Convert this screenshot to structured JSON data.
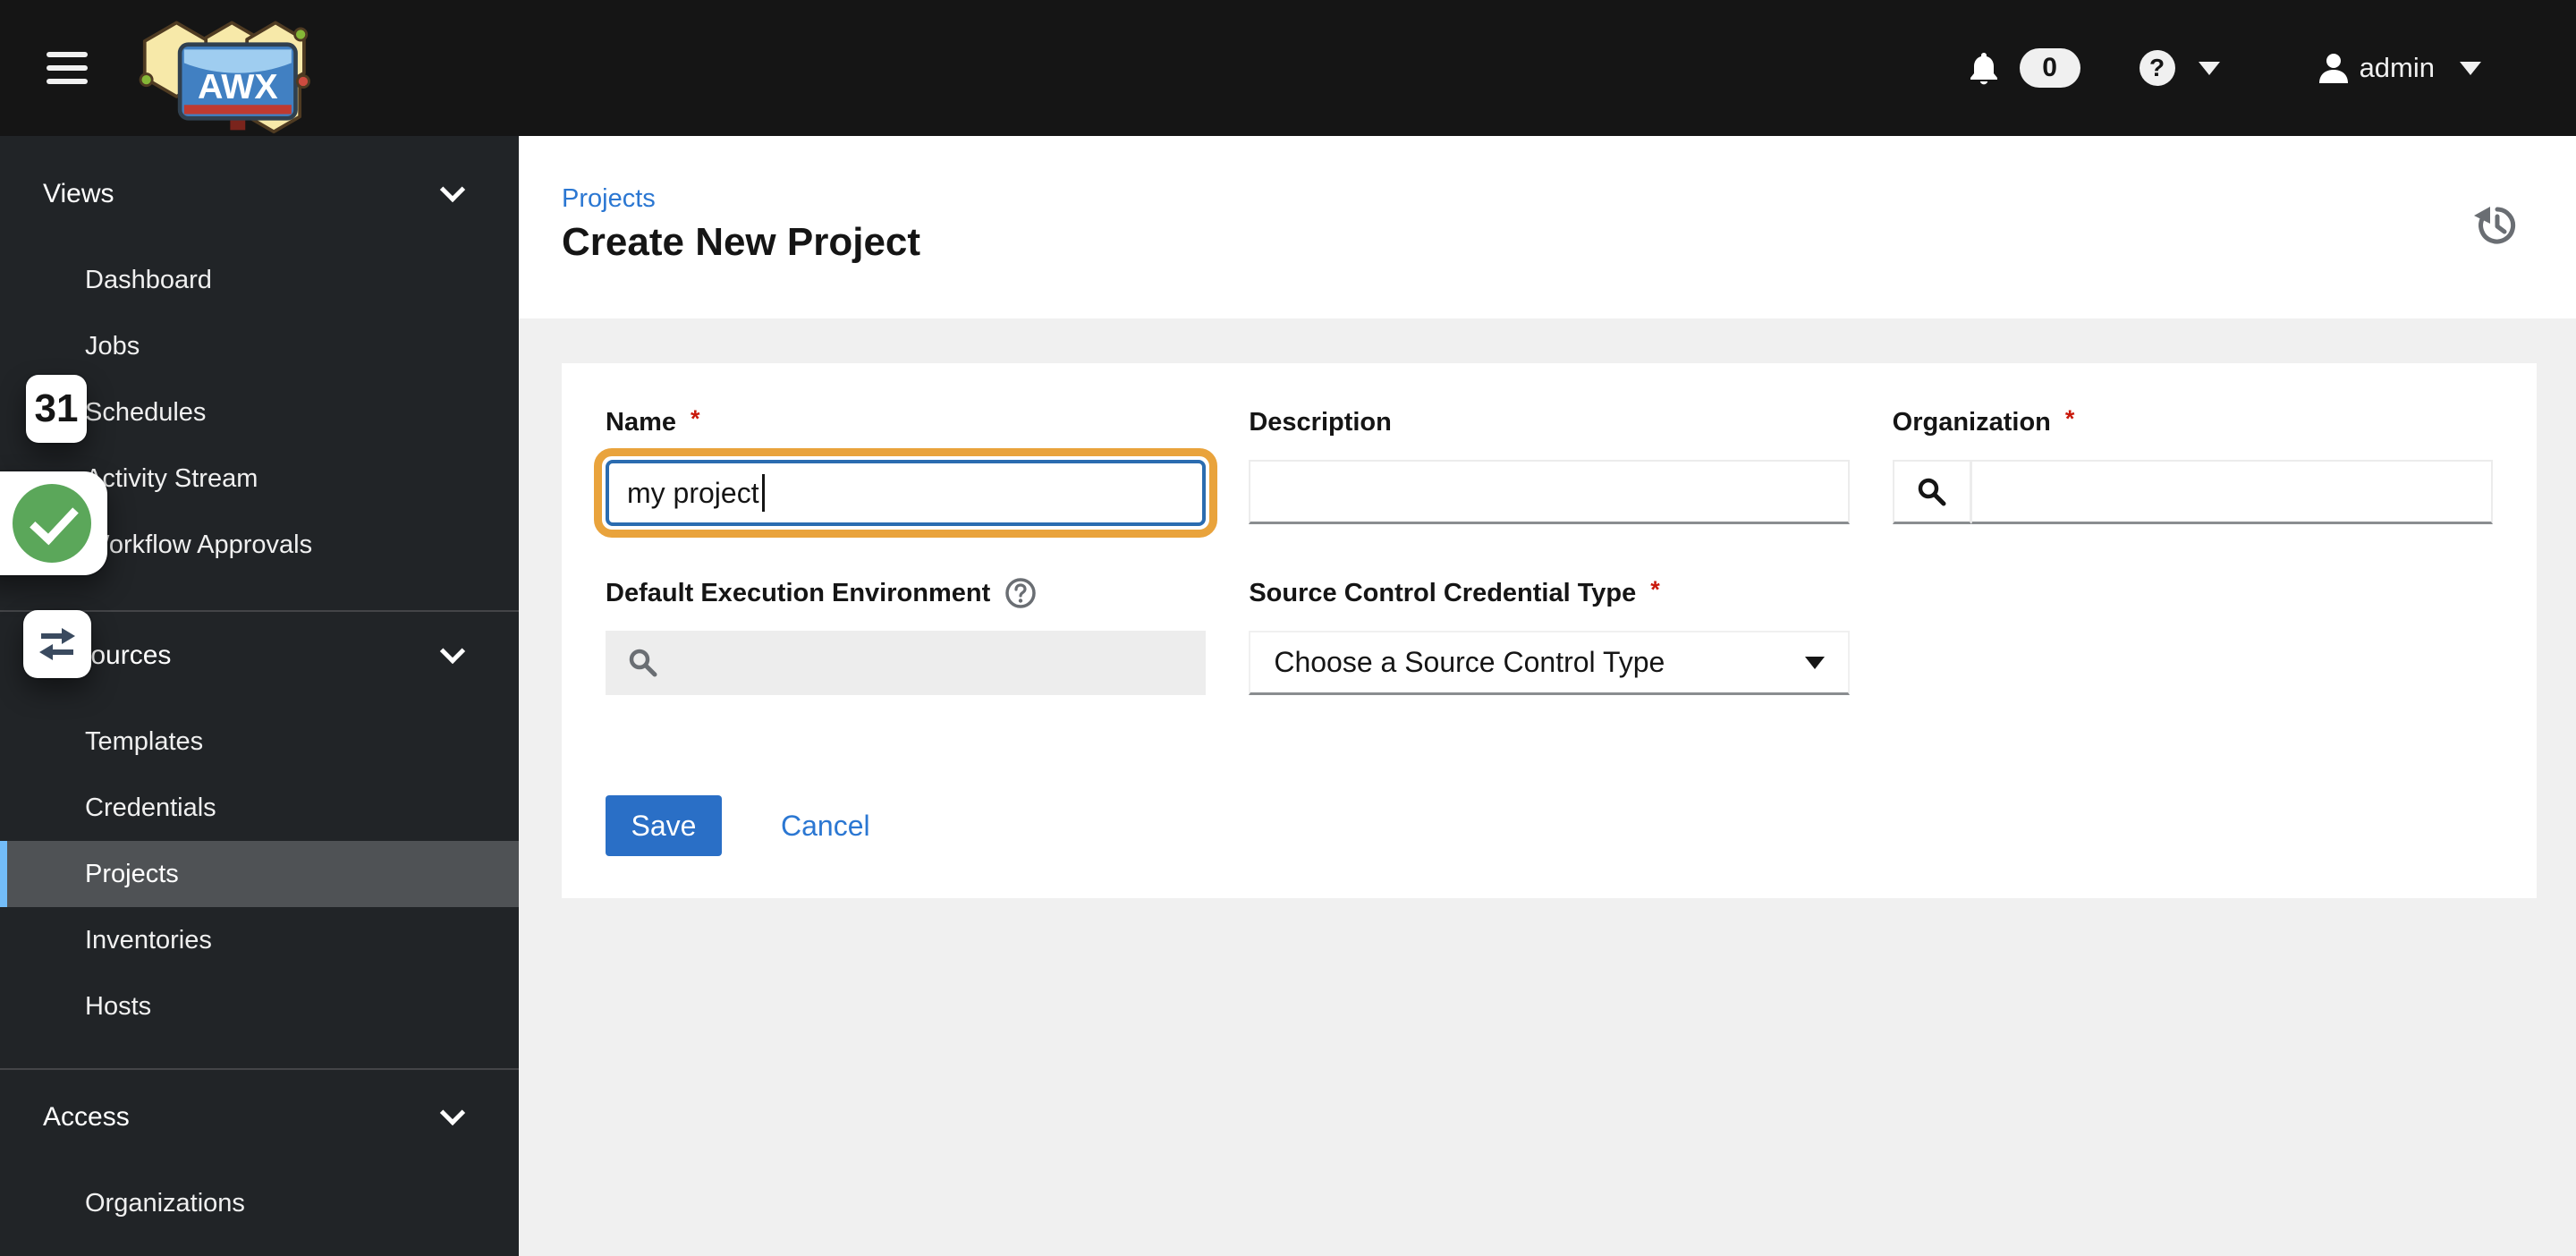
{
  "masthead": {
    "logo_text": "AWX",
    "notifications_count": "0",
    "help_glyph": "?",
    "user": "admin"
  },
  "sidebar": {
    "sections": [
      {
        "label": "Views",
        "items": [
          {
            "label": "Dashboard"
          },
          {
            "label": "Jobs"
          },
          {
            "label": "Schedules"
          },
          {
            "label": "Activity Stream"
          },
          {
            "label": "Workflow Approvals"
          }
        ]
      },
      {
        "label": "Resources",
        "items": [
          {
            "label": "Templates"
          },
          {
            "label": "Credentials"
          },
          {
            "label": "Projects",
            "selected": true
          },
          {
            "label": "Inventories"
          },
          {
            "label": "Hosts"
          }
        ]
      },
      {
        "label": "Access",
        "items": [
          {
            "label": "Organizations"
          }
        ]
      }
    ]
  },
  "overlays": {
    "tab_count": "31"
  },
  "page": {
    "breadcrumb": "Projects",
    "title": "Create New Project"
  },
  "form": {
    "required_marker": "*",
    "name_label": "Name",
    "name_value": "my project",
    "description_label": "Description",
    "organization_label": "Organization",
    "default_ee_label": "Default Execution Environment",
    "scm_cred_label": "Source Control Credential Type",
    "scm_cred_value": "Choose a Source Control Type",
    "save_label": "Save",
    "cancel_label": "Cancel"
  },
  "colors": {
    "masthead_bg": "#151515",
    "sidebar_bg": "#212427",
    "sidebar_selected_bg": "#4f5255",
    "sidebar_selected_border": "#73bcf7",
    "link_blue": "#2b77d2",
    "primary_blue": "#2a6fc6",
    "focus_blue": "#2b6cb0",
    "annotation_orange": "#e9a33c",
    "required_red": "#c9190b",
    "page_bg": "#f0f0f0",
    "card_bg": "#ffffff",
    "input_bottom_border": "#8a8d90",
    "muted_icon": "#6a6e73",
    "check_green": "#5ba75a",
    "swap_icon": "#3a4a5f"
  }
}
